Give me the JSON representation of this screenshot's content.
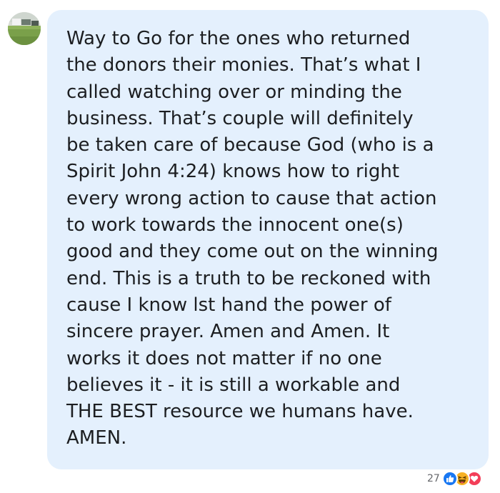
{
  "comment": {
    "text": "Way to Go for the ones who returned\nthe donors their monies. That’s what I\ncalled watching over or minding the\nbusiness. That’s couple will definitely\nbe taken care of because God (who is a\nSpirit John 4:24) knows how to right\nevery wrong action to cause that action\nto work towards the innocent one(s)\ngood and they come out on the winning\nend. This is a truth to be reckoned with\ncause I know lst hand the power of\nsincere prayer. Amen and Amen. It\nworks it does not matter if no one\nbelieves it - it is still a workable and\nTHE BEST resource we humans have.\nAMEN."
  },
  "reactions": {
    "count": "27",
    "icons": [
      "like-icon",
      "haha-icon",
      "love-icon"
    ]
  },
  "colors": {
    "bubble_bg": "#e4f0fd",
    "text": "#1c1e21",
    "meta_text": "#65676b",
    "like": "#1877f2",
    "haha": "#f7b125",
    "love": "#f33e58"
  }
}
